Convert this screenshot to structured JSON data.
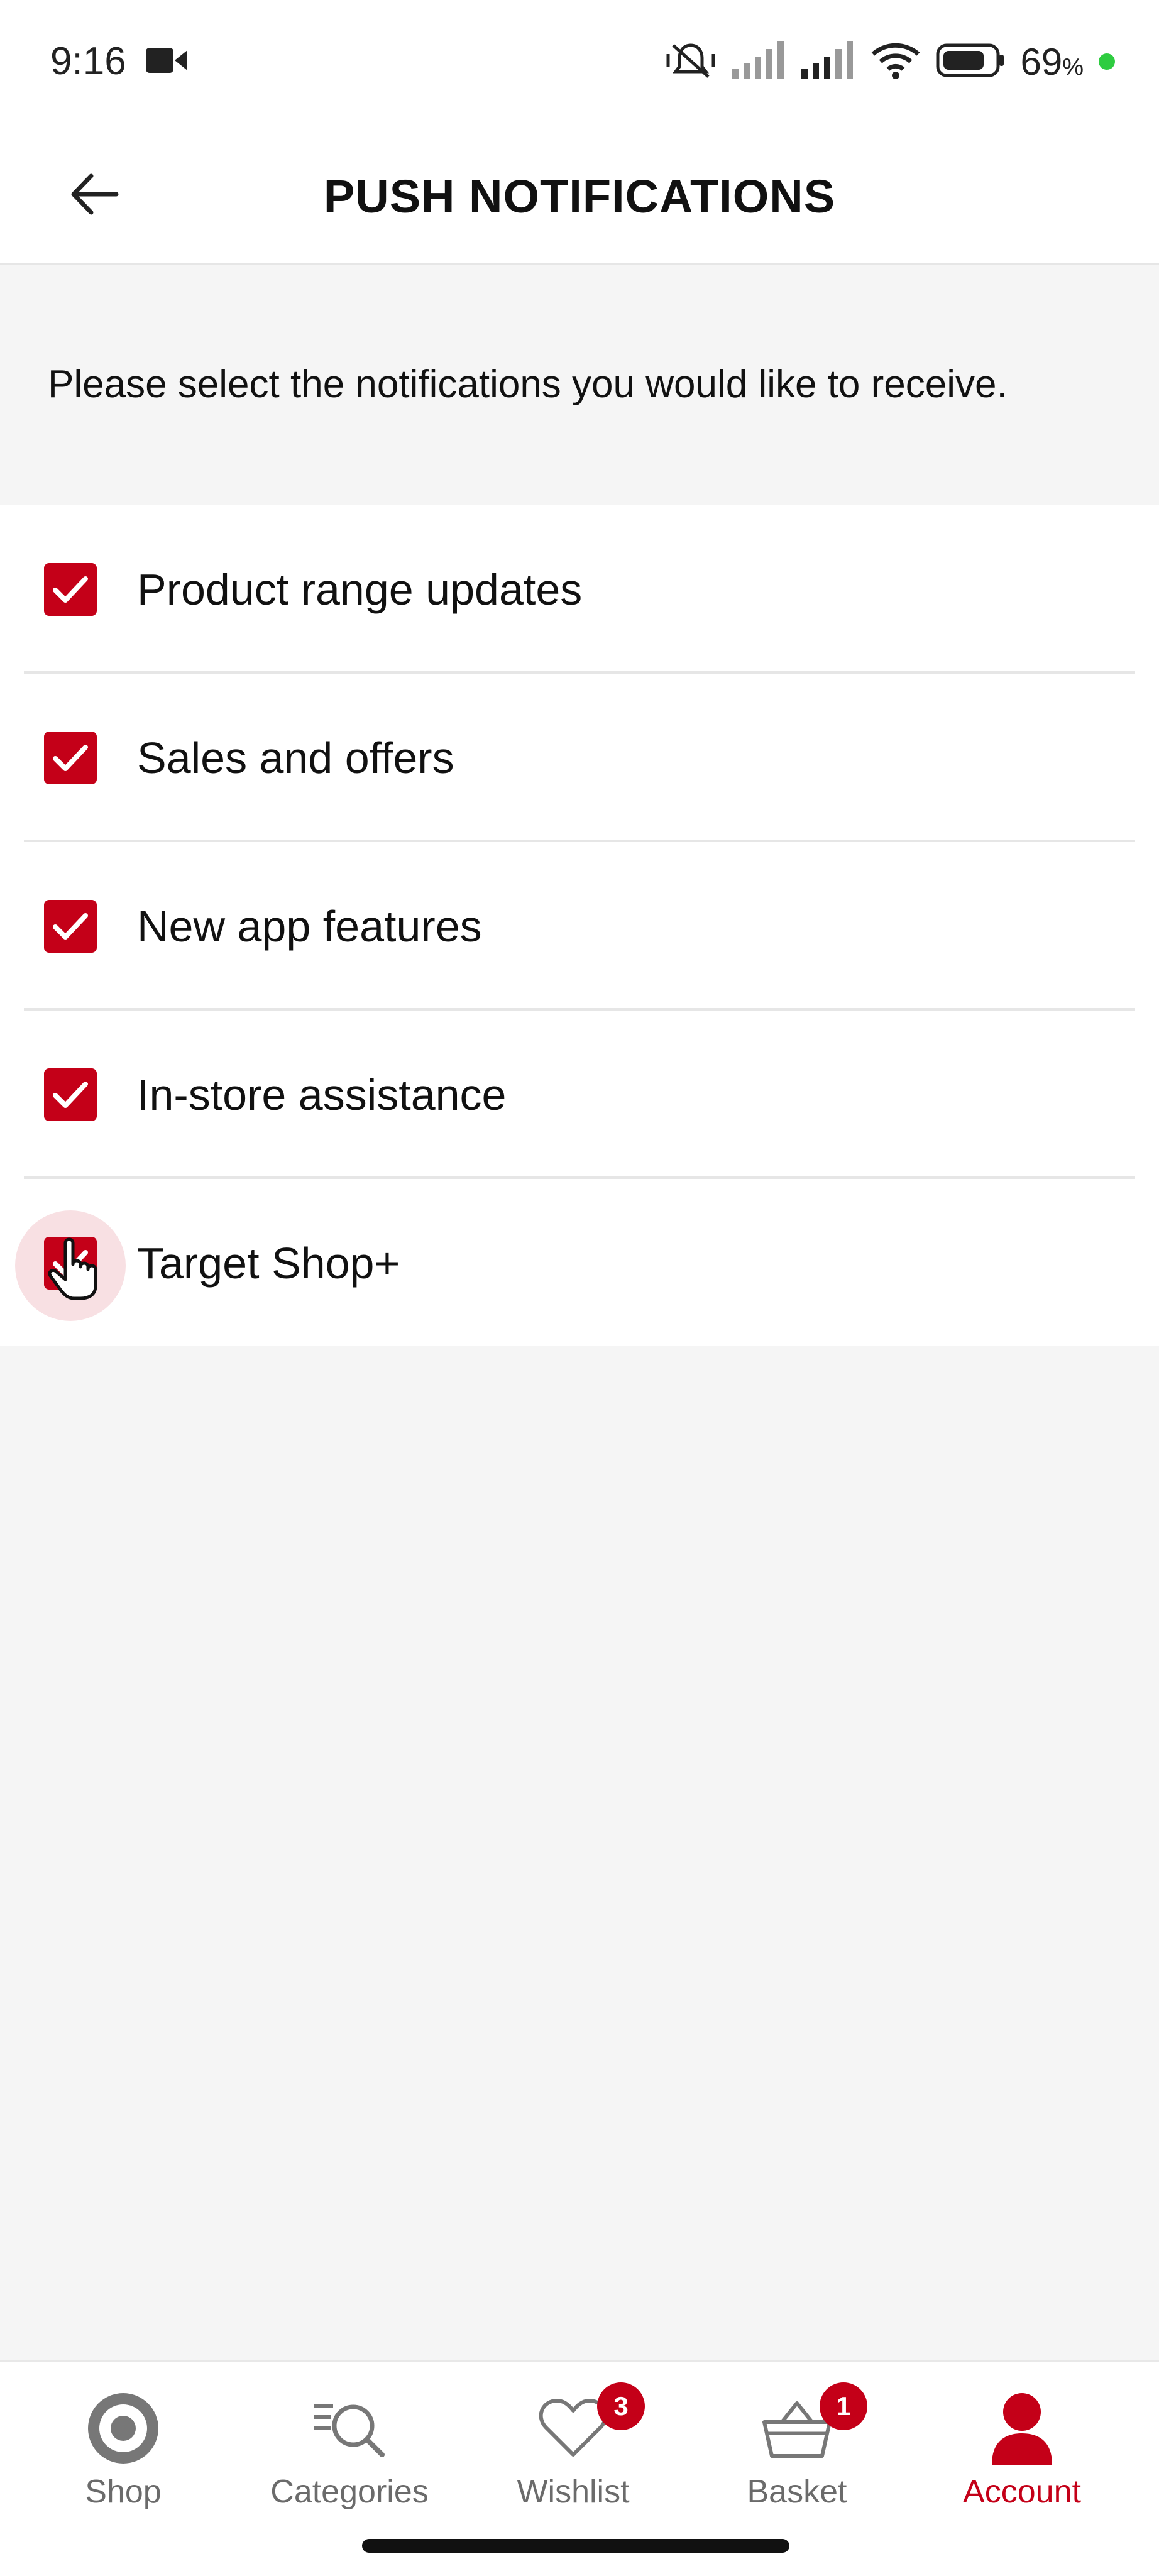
{
  "status_bar": {
    "time": "9:16",
    "battery_text": "69",
    "battery_unit": "%",
    "icons": [
      "video-camera-icon",
      "muted-vibrate-icon",
      "signal-icon",
      "signal-icon",
      "wifi-icon",
      "battery-icon"
    ]
  },
  "header": {
    "title": "PUSH NOTIFICATIONS",
    "back_icon": "arrow-left-icon"
  },
  "intro": {
    "text": "Please select the notifications you would like to receive."
  },
  "options": [
    {
      "label": "Product range updates",
      "checked": true
    },
    {
      "label": "Sales and offers",
      "checked": true
    },
    {
      "label": "New app features",
      "checked": true
    },
    {
      "label": "In-store assistance",
      "checked": true
    },
    {
      "label": "Target Shop+",
      "checked": true
    }
  ],
  "bottom_nav": {
    "items": [
      {
        "label": "Shop",
        "icon": "target-logo-icon",
        "active": false
      },
      {
        "label": "Categories",
        "icon": "categories-search-icon",
        "active": false
      },
      {
        "label": "Wishlist",
        "icon": "heart-icon",
        "badge": "3",
        "active": false
      },
      {
        "label": "Basket",
        "icon": "basket-icon",
        "badge": "1",
        "active": false
      },
      {
        "label": "Account",
        "icon": "person-icon",
        "active": true
      }
    ]
  },
  "colors": {
    "accent": "#c40018",
    "background": "#f5f5f5",
    "surface": "#ffffff",
    "inactive": "#6b6b6b"
  }
}
